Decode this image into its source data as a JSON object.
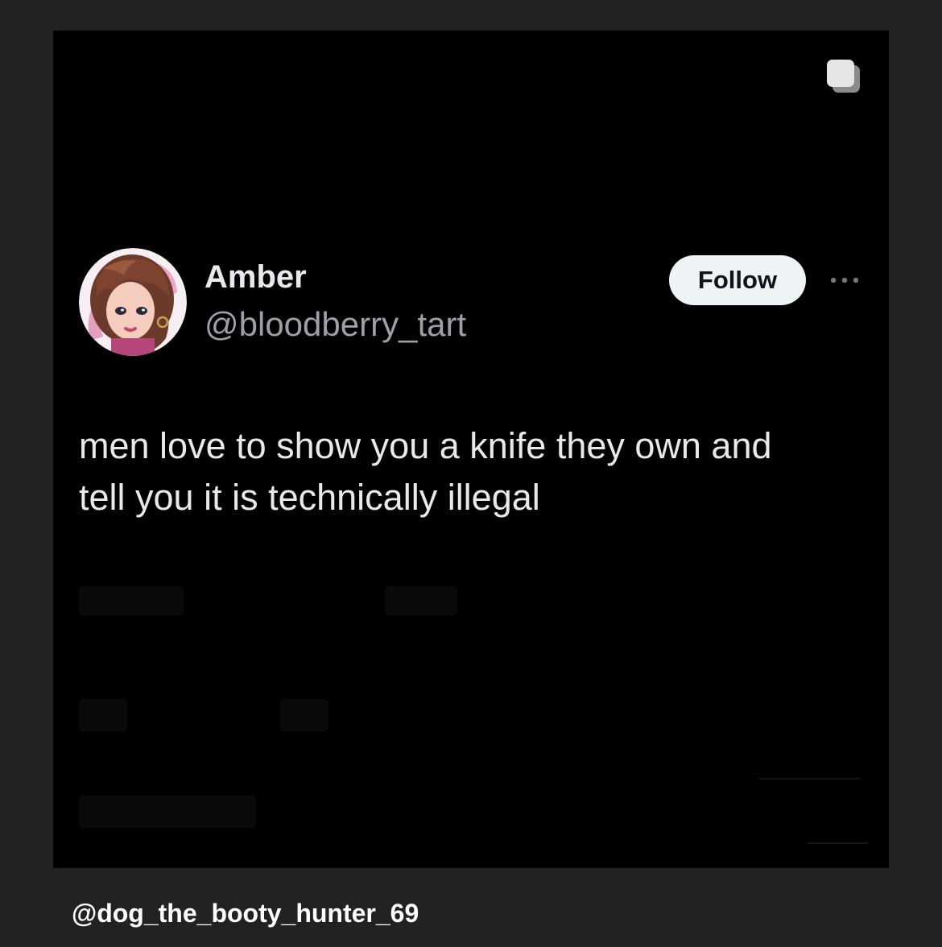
{
  "post": {
    "author": {
      "display_name": "Amber",
      "handle": "@bloodberry_tart"
    },
    "follow_label": "Follow",
    "text_lines": [
      "men love to show you a knife they own and",
      "tell you it is technically illegal"
    ],
    "icons": {
      "multi_image": "multiple-images-icon",
      "more": "more-options-icon"
    }
  },
  "watermark": "@dog_the_booty_hunter_69",
  "colors": {
    "page_background": "#222222",
    "post_background": "#000000",
    "primary_text": "#e7e9ea",
    "secondary_text": "#9da1a6",
    "follow_button_bg": "#eff3f4",
    "follow_button_text": "#0f1419"
  }
}
